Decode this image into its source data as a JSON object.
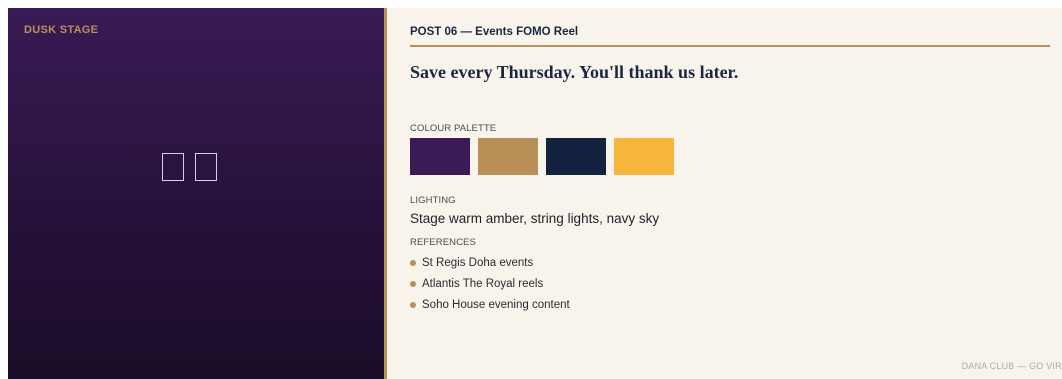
{
  "stage": {
    "label": "DUSK STAGE",
    "glyphs": [
      "empty-box-glyph",
      "empty-box-glyph"
    ]
  },
  "card": {
    "post_title": "POST 06 — Events FOMO Reel",
    "headline": "Save every Thursday. You'll thank us later.",
    "palette_label": "COLOUR PALETTE",
    "palette": [
      "#3b1b56",
      "#b89058",
      "#13233f",
      "#f6b53b"
    ],
    "lighting_label": "LIGHTING",
    "lighting_value": "Stage warm amber, string lights, navy sky",
    "references_label": "REFERENCES",
    "references": [
      "St Regis Doha events",
      "Atlantis The Royal reels",
      "Soho House evening content"
    ],
    "footer": "DANA CLUB — GO VIRA"
  },
  "colors": {
    "accent_gold": "#b89058",
    "navy": "#1b2640",
    "stage_purple": "#3a1a55",
    "card_background": "#f8f4ec"
  }
}
